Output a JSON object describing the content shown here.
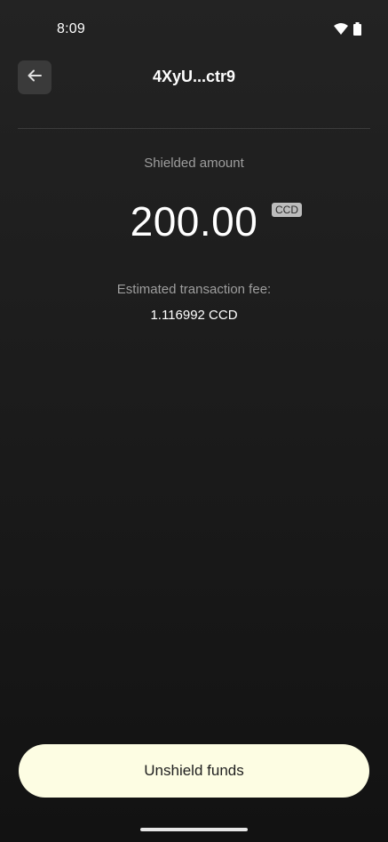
{
  "status_bar": {
    "time": "8:09",
    "icons": [
      "wifi-icon",
      "battery-icon"
    ]
  },
  "header": {
    "title": "4XyU...ctr9",
    "back_icon": "arrow-left-icon"
  },
  "amount": {
    "label": "Shielded amount",
    "value": "200.00",
    "currency_badge": "CCD"
  },
  "fee": {
    "label": "Estimated transaction fee:",
    "value": "1.116992 CCD"
  },
  "actions": {
    "unshield_label": "Unshield funds"
  },
  "colors": {
    "background": "#1c1c1c",
    "button_bg": "#fdfde3",
    "muted_text": "#9e9e9e"
  }
}
